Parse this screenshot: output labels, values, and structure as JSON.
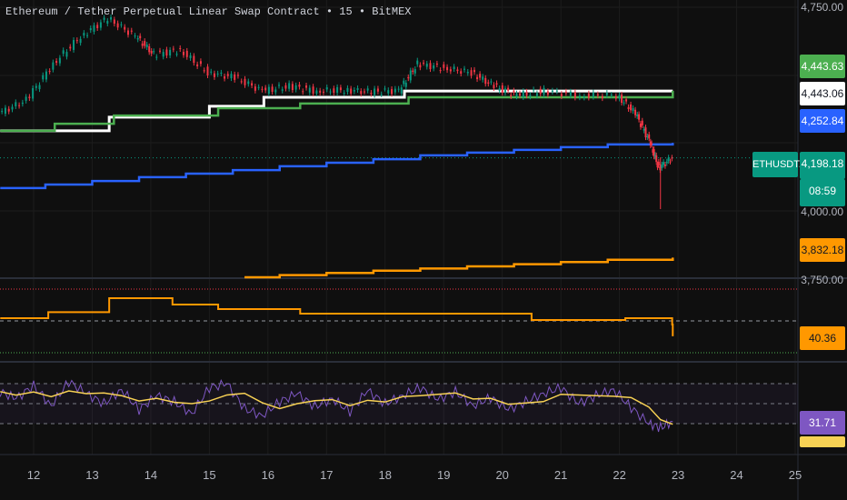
{
  "header": {
    "title": "Ethereum / Tether Perpetual Linear Swap Contract • 15 • BitMEX"
  },
  "symbol_tag": "ETHUSDT.P",
  "colors": {
    "bg": "#0f0f0f",
    "up": "#089981",
    "down": "#f23645",
    "white": "#ffffff",
    "green": "#4caf50",
    "blue": "#2962ff",
    "orange": "#ff9800",
    "purple": "#7e57c2",
    "yellow": "#f7d154"
  },
  "price_labels": [
    {
      "text": "4,443.63",
      "bg": "#4caf50",
      "fg": "#ffffff"
    },
    {
      "text": "4,443.06",
      "bg": "#ffffff",
      "fg": "#131722"
    },
    {
      "text": "4,252.84",
      "bg": "#2962ff",
      "fg": "#ffffff"
    },
    {
      "text": "4,198.18",
      "bg": "#089981",
      "fg": "#ffffff"
    },
    {
      "text": "08:59",
      "bg": "#089981",
      "fg": "#ffffff"
    },
    {
      "text": "3,832.18",
      "bg": "#ff9800",
      "fg": "#131722"
    },
    {
      "text": "40.36",
      "bg": "#ff9800",
      "fg": "#131722"
    },
    {
      "text": "31.71",
      "bg": "#7e57c2",
      "fg": "#ffffff"
    }
  ],
  "chart_data": {
    "type": "line",
    "title": "Ethereum / Tether Perpetual Linear Swap Contract • 15 • BitMEX",
    "x_ticks": [
      "12",
      "13",
      "14",
      "15",
      "16",
      "17",
      "18",
      "19",
      "20",
      "21",
      "22",
      "23",
      "24",
      "25"
    ],
    "x_tick_values": [
      12,
      13,
      14,
      15,
      16,
      17,
      18,
      19,
      20,
      21,
      22,
      23,
      24,
      25
    ],
    "xlim": [
      11.43,
      25.0
    ],
    "price_axis": {
      "ticks": [
        "4,750.00",
        "4,000.00",
        "3,750.00"
      ],
      "tick_values": [
        4750,
        4000,
        3750
      ],
      "ylim": [
        3740,
        4770
      ]
    },
    "price": {
      "name": "ETHUSDT.P",
      "x": [
        11.43,
        11.9,
        12.36,
        12.83,
        13.29,
        13.76,
        14.07,
        14.53,
        15.0,
        15.46,
        15.93,
        16.39,
        16.86,
        17.33,
        17.79,
        18.26,
        18.57,
        19.03,
        19.5,
        19.88,
        20.27,
        20.74,
        21.36,
        21.98,
        22.29,
        22.52,
        22.68,
        22.91
      ],
      "close": [
        4360,
        4410,
        4543,
        4643,
        4710,
        4643,
        4577,
        4593,
        4510,
        4493,
        4443,
        4460,
        4443,
        4447,
        4440,
        4445,
        4543,
        4527,
        4510,
        4460,
        4427,
        4443,
        4427,
        4427,
        4360,
        4260,
        4160,
        4198
      ]
    },
    "series": [
      {
        "name": "upper-white",
        "color": "#ffffff",
        "x": [
          11.43,
          13.29,
          15.0,
          15.93,
          18.33,
          22.91
        ],
        "y": [
          4297,
          4347,
          4387,
          4420,
          4443,
          4443
        ]
      },
      {
        "name": "upper-green",
        "color": "#4caf50",
        "x": [
          11.43,
          12.36,
          13.37,
          15.15,
          16.55,
          18.4,
          22.91
        ],
        "y": [
          4297,
          4323,
          4353,
          4380,
          4397,
          4420,
          4443.63
        ]
      },
      {
        "name": "middle-blue",
        "color": "#2962ff",
        "x": [
          11.43,
          12.2,
          13.0,
          13.8,
          14.6,
          15.4,
          16.2,
          17.0,
          17.8,
          18.6,
          19.4,
          20.2,
          21.0,
          21.8,
          22.91
        ],
        "y": [
          4087,
          4100,
          4113,
          4127,
          4140,
          4153,
          4167,
          4180,
          4193,
          4207,
          4217,
          4227,
          4237,
          4247,
          4252.84
        ]
      },
      {
        "name": "lower-orange",
        "color": "#ff9800",
        "x": [
          15.6,
          16.2,
          17.0,
          17.8,
          18.6,
          19.4,
          20.2,
          21.0,
          21.8,
          22.91
        ],
        "y": [
          3760,
          3768,
          3776,
          3784,
          3792,
          3800,
          3808,
          3816,
          3824,
          3832.18
        ]
      }
    ],
    "panel2": {
      "name": "orange-oscillator",
      "color": "#ff9800",
      "levels": [
        70,
        50,
        30
      ],
      "ylim": [
        20,
        80
      ],
      "x": [
        11.43,
        12.25,
        13.29,
        14.37,
        15.15,
        16.55,
        20.5,
        22.1,
        22.9,
        22.91
      ],
      "y": [
        51.7,
        55.5,
        64.3,
        60.3,
        57.4,
        54.6,
        50.6,
        51.7,
        47.7,
        40.36
      ]
    },
    "rsi": {
      "name": "RSI",
      "color": "#7e57c2",
      "ma_color": "#f7d154",
      "levels": [
        70,
        50,
        30
      ],
      "ylim": [
        10,
        90
      ],
      "value": 31.71,
      "x": [
        11.43,
        11.7,
        12.0,
        12.3,
        12.6,
        12.9,
        13.2,
        13.5,
        13.8,
        14.1,
        14.4,
        14.7,
        15.0,
        15.3,
        15.6,
        15.9,
        16.2,
        16.5,
        16.8,
        17.1,
        17.4,
        17.7,
        18.0,
        18.3,
        18.6,
        18.9,
        19.2,
        19.5,
        19.8,
        20.1,
        20.4,
        20.7,
        21.0,
        21.3,
        21.6,
        21.9,
        22.2,
        22.5,
        22.7,
        22.91
      ],
      "y": [
        62,
        55,
        68,
        48,
        72,
        60,
        50,
        64,
        44,
        58,
        52,
        40,
        66,
        70,
        45,
        38,
        52,
        60,
        47,
        55,
        42,
        63,
        50,
        58,
        66,
        54,
        62,
        48,
        56,
        44,
        52,
        60,
        66,
        50,
        58,
        64,
        46,
        30,
        26,
        32
      ]
    }
  }
}
